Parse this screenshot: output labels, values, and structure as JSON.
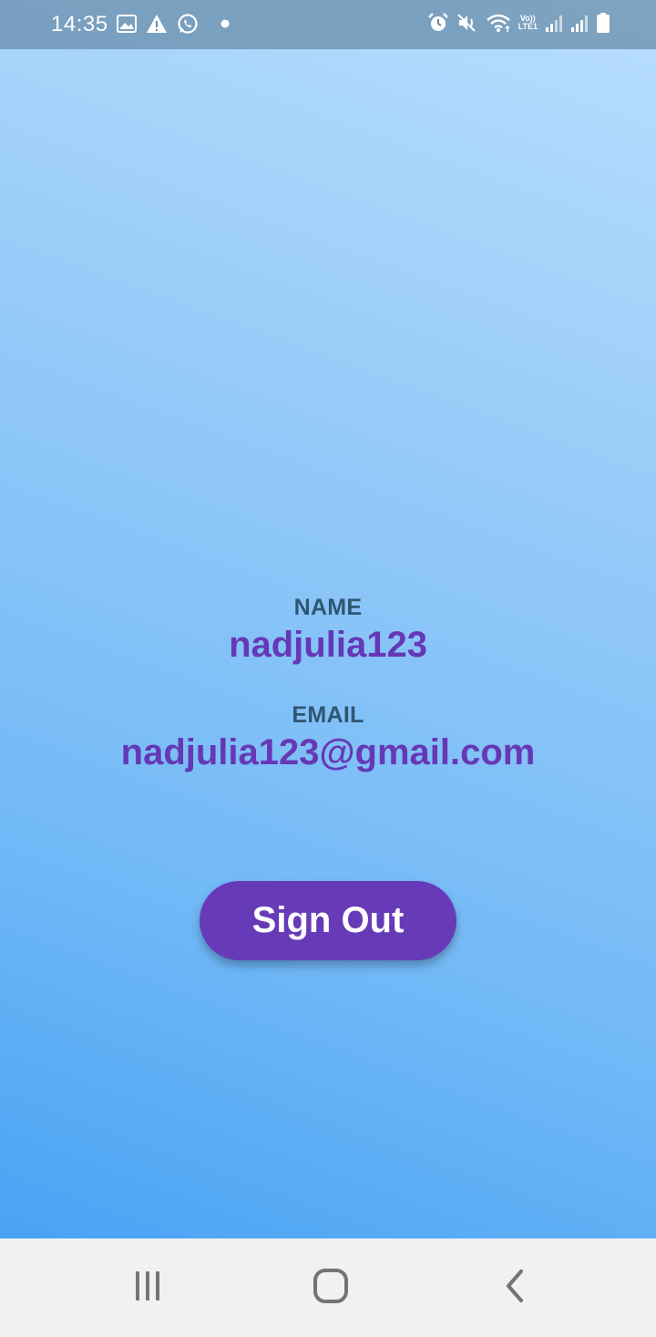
{
  "status_bar": {
    "time": "14:35",
    "left_icons": [
      "gallery-icon",
      "warning-icon",
      "whatsapp-icon",
      "dot-icon"
    ],
    "right_icons": [
      "alarm-icon",
      "mute-icon",
      "wifi-icon",
      "volte-icon",
      "signal-icon",
      "signal-icon",
      "battery-icon"
    ],
    "volte_text_top": "Vo))",
    "volte_text_bottom": "LTE1"
  },
  "profile": {
    "name_label": "NAME",
    "name_value": "nadjulia123",
    "email_label": "EMAIL",
    "email_value": "nadjulia123@gmail.com"
  },
  "actions": {
    "sign_out_label": "Sign Out"
  },
  "nav_bar": {
    "buttons": [
      "recents-icon",
      "home-icon",
      "back-icon"
    ]
  },
  "colors": {
    "accent": "#673ab7",
    "value_text": "#6638b5",
    "label_text": "#2f5673",
    "background_top": "#b9defd",
    "background_bottom": "#49a3f3"
  }
}
